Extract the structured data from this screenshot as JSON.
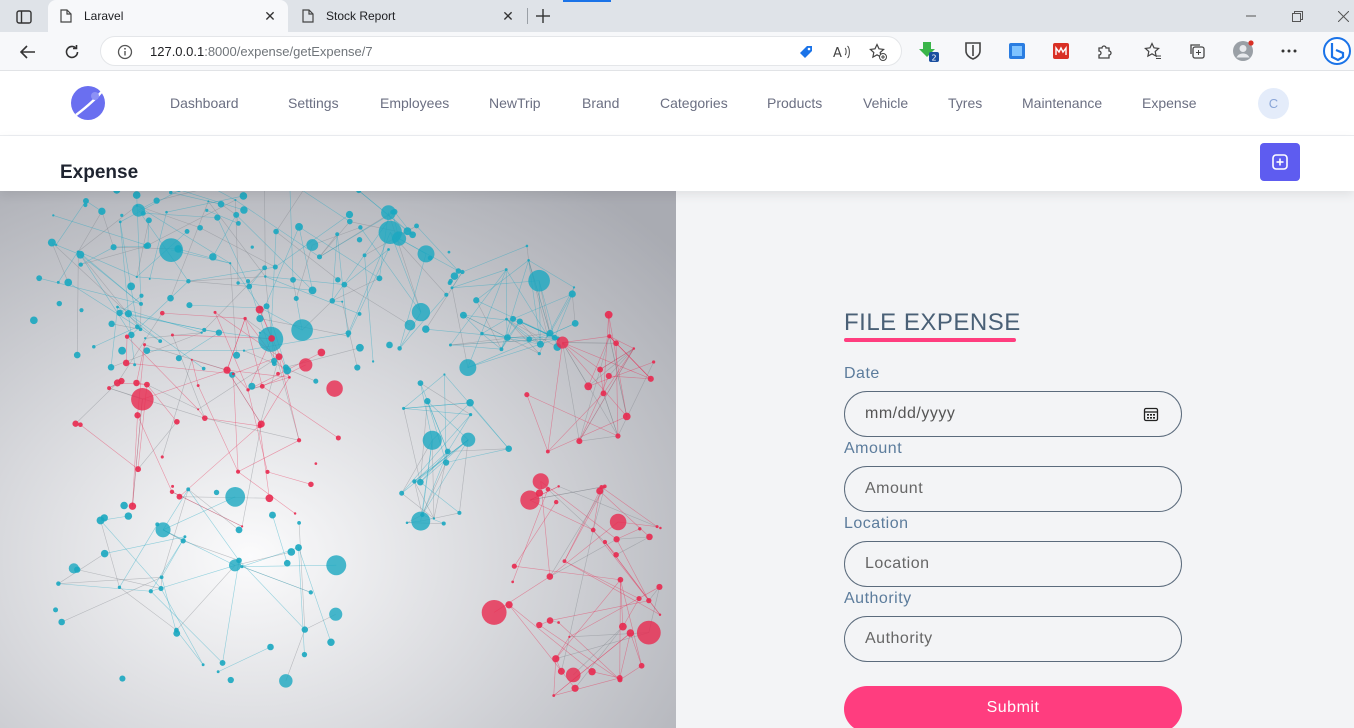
{
  "browser": {
    "tabs": [
      {
        "title": "Laravel",
        "active": true
      },
      {
        "title": "Stock Report",
        "active": false
      }
    ],
    "url_host": "127.0.0.1",
    "url_rest": ":8000/expense/getExpense/7",
    "extension_badge": "2"
  },
  "nav": {
    "items": [
      "Dashboard",
      "Settings",
      "Employees",
      "NewTrip",
      "Brand",
      "Categories",
      "Products",
      "Vehicle",
      "Tyres",
      "Maintenance",
      "Expense"
    ],
    "avatar_initial": "C"
  },
  "page": {
    "title": "Expense"
  },
  "form": {
    "title": "FILE EXPENSE",
    "date_label": "Date",
    "date_placeholder": "mm/dd/yyyy",
    "amount_label": "Amount",
    "amount_placeholder": "Amount",
    "location_label": "Location",
    "location_placeholder": "Location",
    "authority_label": "Authority",
    "authority_placeholder": "Authority",
    "submit_label": "Submit"
  },
  "colors": {
    "accent_pink": "#ff3d7f",
    "primary_purple": "#5e5cf0",
    "network_teal": "#1aa7c0",
    "network_red": "#e8294f"
  },
  "icons": {
    "sidebar_toggle": "sidebar-icon",
    "tab_favicon": "page-icon",
    "back": "back-arrow-icon",
    "reload": "reload-icon",
    "info": "info-icon",
    "calendar": "calendar-icon",
    "add": "plus-square-icon"
  }
}
